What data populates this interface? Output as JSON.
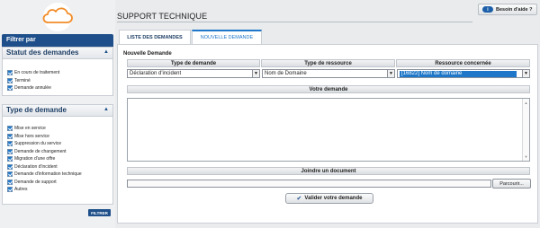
{
  "sidebar": {
    "filter_title": "Filtrer par",
    "status_panel": {
      "title": "Statut des demandes",
      "items": [
        {
          "label": "En cours de traitement",
          "checked": true
        },
        {
          "label": "Terminé",
          "checked": true
        },
        {
          "label": "Demande annulée",
          "checked": true
        }
      ]
    },
    "type_panel": {
      "title": "Type de demande",
      "items": [
        {
          "label": "Mise en service",
          "checked": true
        },
        {
          "label": "Mise hors service",
          "checked": true
        },
        {
          "label": "Suppression du service",
          "checked": true
        },
        {
          "label": "Demande de changement",
          "checked": true
        },
        {
          "label": "Migration d'une offre",
          "checked": true
        },
        {
          "label": "Déclaration d'incident",
          "checked": true
        },
        {
          "label": "Demande d'information technique",
          "checked": true
        },
        {
          "label": "Demande de support",
          "checked": true
        },
        {
          "label": "Autres",
          "checked": true
        }
      ]
    },
    "filter_button": "FILTRER"
  },
  "header": {
    "title": "SUPPORT TECHNIQUE",
    "help_button": "Besoin d'aide ?",
    "help_icon_text": "i"
  },
  "tabs": [
    {
      "label": "LISTE DES DEMANDES",
      "active": false
    },
    {
      "label": "NOUVELLE DEMANDE",
      "active": true
    }
  ],
  "form": {
    "section_title": "Nouvelle Demande",
    "columns": [
      "Type de demande",
      "Type de ressource",
      "Ressource concernée"
    ],
    "type_demande_value": "Déclaration d'incident",
    "type_ressource_value": "Nom de Domaine",
    "ressource_value": "[16822] Nom de domaine",
    "votre_demande_label": "Votre demande",
    "votre_demande_value": "",
    "joindre_label": "Joindre un document",
    "file_value": "",
    "browse_button": "Parcourir...",
    "submit_button": "Valider votre demande"
  },
  "colors": {
    "accent": "#1e4f8a",
    "link": "#1e77c8",
    "logo": "#f28c28"
  }
}
